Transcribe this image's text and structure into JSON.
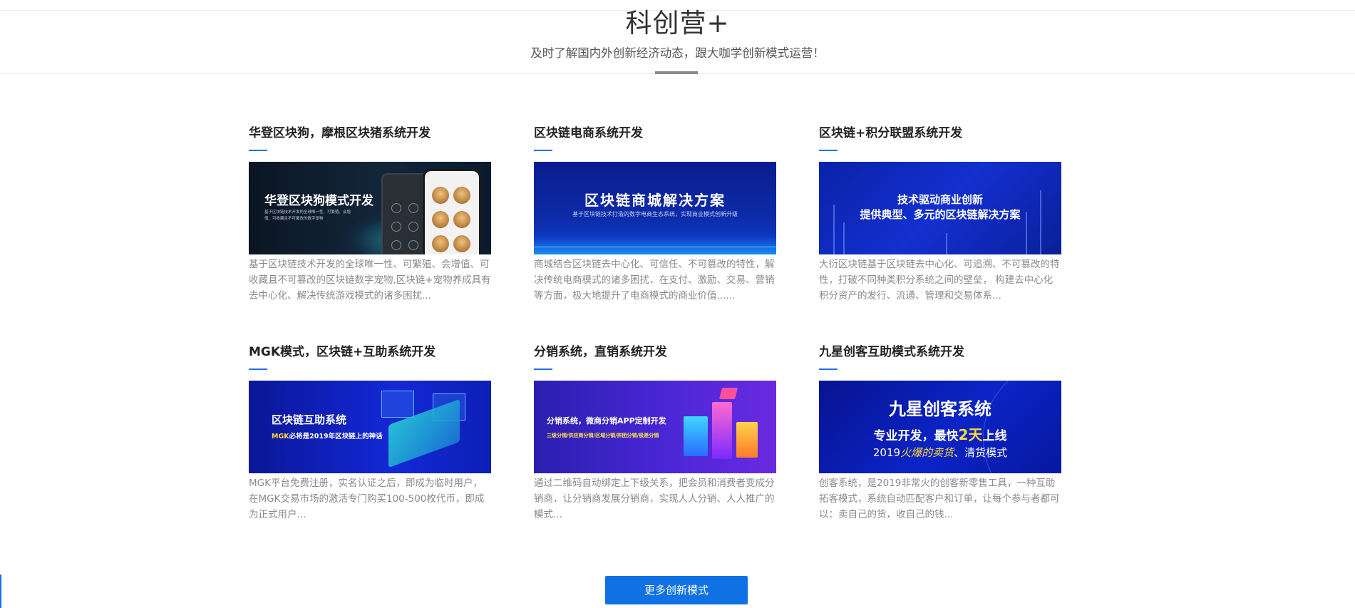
{
  "header": {
    "title": "科创营+",
    "subtitle": "及时了解国内外创新经济动态，跟大咖学创新模式运营！"
  },
  "cards": [
    {
      "title": "华登区块狗，摩根区块猪系统开发",
      "banner_title": "华登区块狗模式开发",
      "banner_sub": "基于区块链技术开发的全球唯一性、可繁殖、会增值、可收藏且不可篡改的数字宠物",
      "description": "基于区块链技术开发的全球唯一性、可繁殖、会增值、可收藏且不可篡改的区块链数字宠物,区块链+宠物养成具有去中心化、解决传统游戏模式的诸多困扰..."
    },
    {
      "title": "区块链电商系统开发",
      "banner_title": "区块链商城解决方案",
      "banner_sub": "基于区块链技术打造的数字电商生态系统，实现商业模式创新升级",
      "description": "商城结合区块链去中心化、可信任、不可篡改的特性，解决传统电商模式的诸多困扰，在支付、激励、交易、营销等方面，极大地提升了电商模式的商业价值......"
    },
    {
      "title": "区块链+积分联盟系统开发",
      "banner_title": "技术驱动商业创新",
      "banner_sub": "提供典型、多元的区块链解决方案",
      "description": "大衍区块链基于区块链去中心化、可追溯、不可篡改的特性，打破不同种类积分系统之间的壁垒， 构建去中心化积分资产的发行、流通、管理和交易体系..."
    },
    {
      "title": "MGK模式，区块链+互助系统开发",
      "banner_title": "区块链互助系统",
      "banner_highlight": "MGK",
      "banner_sub": "必将是2019年区块链上的神话",
      "description": "MGK平台免费注册，实名认证之后，即成为临时用户，在MGK交易市场的激活专门购买100-500枚代币，即成为正式用户..."
    },
    {
      "title": "分销系统，直销系统开发",
      "banner_title": "分销系统，微商分销APP定制开发",
      "banner_sub": "三级分销/供应商分销/区域分销/拼团分销/极差分销",
      "description": "通过二维码自动绑定上下级关系，把会员和消费者变成分销商，让分销商发展分销商，实现人人分销、人人推广的模式..."
    },
    {
      "title": "九星创客互助模式系统开发",
      "banner_title": "九星创客系统",
      "banner_line2_a": "专业开发，最快",
      "banner_line2_hl": "2天",
      "banner_line2_b": "上线",
      "banner_line3_a": "2019",
      "banner_line3_hl": "火爆的卖货",
      "banner_line3_b": "、清货模式",
      "description": "创客系统，是2019非常火的创客新零售工具，一种互助拓客模式，系统自动匹配客户和订单，让每个参与者都可以：卖自己的货，收自己的钱..."
    }
  ],
  "more_button": "更多创新模式",
  "colors": {
    "accent": "#1071e5",
    "highlight_yellow": "#ffd83a"
  }
}
